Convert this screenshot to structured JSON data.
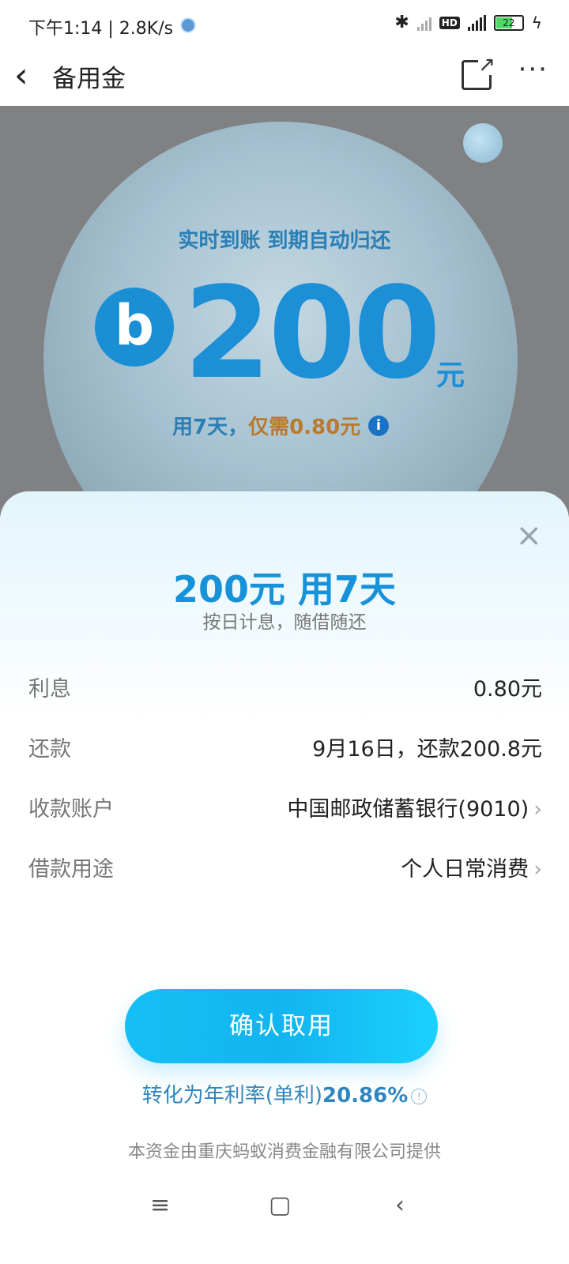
{
  "status": {
    "time": "下午1:14 | 2.8K/s",
    "battery": "22"
  },
  "header": {
    "back": "‹",
    "title": "备用金",
    "more": "···"
  },
  "hero": {
    "slogan": "实时到账 到期自动归还",
    "logo": "b",
    "amount": "200",
    "unit": "元",
    "sub_prefix": "用7天，",
    "sub_price": "仅需0.80元",
    "info": "i"
  },
  "sheet": {
    "close": "×",
    "headline": "200元 用7天",
    "tagline": "按日计息，随借随还",
    "rows": [
      {
        "label": "利息",
        "value": "0.80元"
      },
      {
        "label": "还款",
        "value": "9月16日，还款200.8元"
      },
      {
        "label": "收款账户",
        "value": "中国邮政储蓄银行(9010)"
      },
      {
        "label": "借款用途",
        "value": "个人日常消费"
      }
    ],
    "chevron": "›",
    "confirm": "确认取用",
    "rate_prefix": "转化为年利率(单利)",
    "rate_value": "20.86%",
    "rate_icon": "!",
    "provider": "本资金由重庆蚂蚁消费金融有限公司提供"
  },
  "sysnav": {
    "menu": "≡",
    "home": "▢",
    "back": "‹"
  },
  "colors": {
    "accent": "#1792d9",
    "button": "#15bff4",
    "price": "#b97a2e"
  }
}
